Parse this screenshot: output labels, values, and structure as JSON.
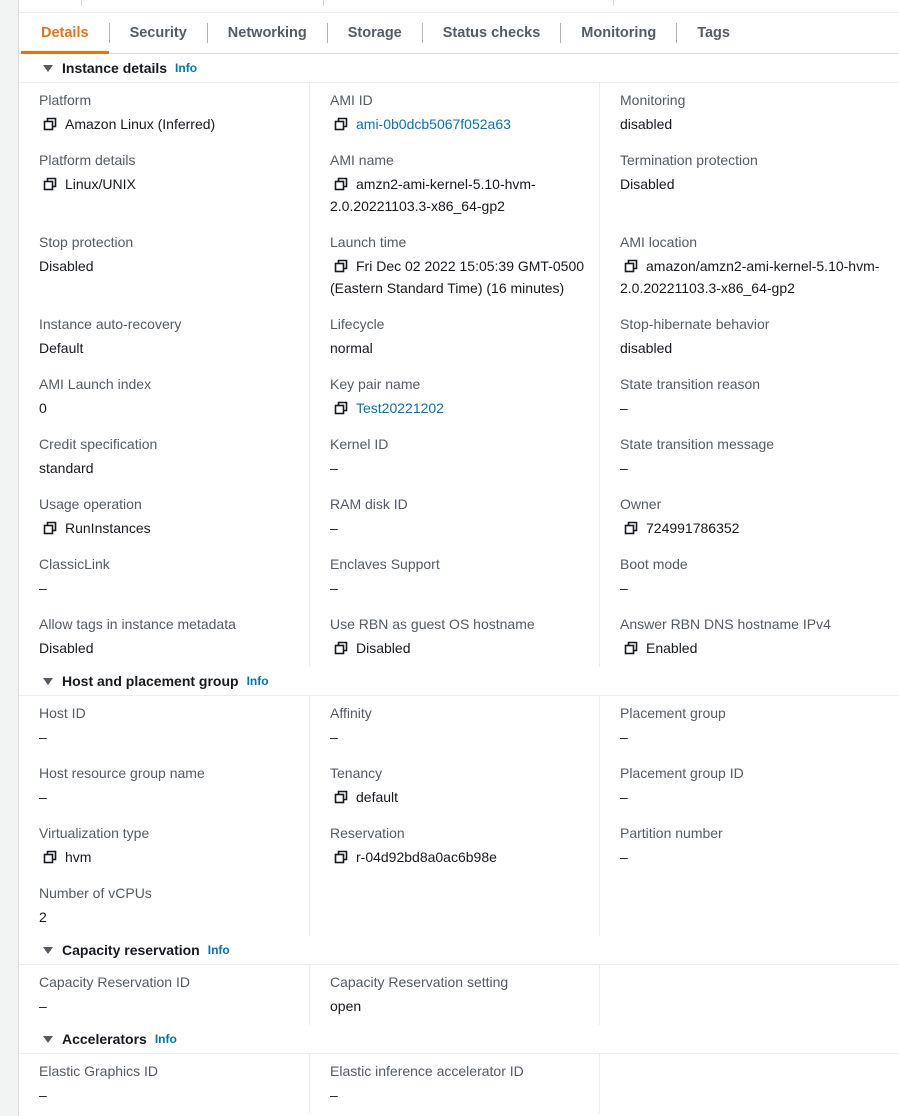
{
  "tabs": [
    "Details",
    "Security",
    "Networking",
    "Storage",
    "Status checks",
    "Monitoring",
    "Tags"
  ],
  "info_label": "Info",
  "sections": {
    "instance_details": {
      "title": "Instance details",
      "fields": [
        {
          "label": "Platform",
          "value": "Amazon Linux (Inferred)",
          "copy": true
        },
        {
          "label": "AMI ID",
          "value": "ami-0b0dcb5067f052a63",
          "copy": true,
          "link": true
        },
        {
          "label": "Monitoring",
          "value": "disabled"
        },
        {
          "label": "Platform details",
          "value": "Linux/UNIX",
          "copy": true
        },
        {
          "label": "AMI name",
          "value": "amzn2-ami-kernel-5.10-hvm-2.0.20221103.3-x86_64-gp2",
          "copy": true
        },
        {
          "label": "Termination protection",
          "value": "Disabled"
        },
        {
          "label": "Stop protection",
          "value": "Disabled"
        },
        {
          "label": "Launch time",
          "value": "Fri Dec 02 2022 15:05:39 GMT-0500 (Eastern Standard Time) (16 minutes)",
          "copy": true
        },
        {
          "label": "AMI location",
          "value": "amazon/amzn2-ami-kernel-5.10-hvm-2.0.20221103.3-x86_64-gp2",
          "copy": true
        },
        {
          "label": "Instance auto-recovery",
          "value": "Default"
        },
        {
          "label": "Lifecycle",
          "value": "normal"
        },
        {
          "label": "Stop-hibernate behavior",
          "value": "disabled"
        },
        {
          "label": "AMI Launch index",
          "value": "0"
        },
        {
          "label": "Key pair name",
          "value": "Test20221202",
          "copy": true,
          "link": true
        },
        {
          "label": "State transition reason",
          "value": "–"
        },
        {
          "label": "Credit specification",
          "value": "standard"
        },
        {
          "label": "Kernel ID",
          "value": "–"
        },
        {
          "label": "State transition message",
          "value": "–"
        },
        {
          "label": "Usage operation",
          "value": "RunInstances",
          "copy": true
        },
        {
          "label": "RAM disk ID",
          "value": "–"
        },
        {
          "label": "Owner",
          "value": "724991786352",
          "copy": true
        },
        {
          "label": "ClassicLink",
          "value": "–"
        },
        {
          "label": "Enclaves Support",
          "value": "–"
        },
        {
          "label": "Boot mode",
          "value": "–"
        },
        {
          "label": "Allow tags in instance metadata",
          "value": "Disabled"
        },
        {
          "label": "Use RBN as guest OS hostname",
          "value": "Disabled",
          "copy": true
        },
        {
          "label": "Answer RBN DNS hostname IPv4",
          "value": "Enabled",
          "copy": true
        }
      ]
    },
    "host_placement": {
      "title": "Host and placement group",
      "fields": [
        {
          "label": "Host ID",
          "value": "–"
        },
        {
          "label": "Affinity",
          "value": "–"
        },
        {
          "label": "Placement group",
          "value": "–"
        },
        {
          "label": "Host resource group name",
          "value": "–"
        },
        {
          "label": "Tenancy",
          "value": "default",
          "copy": true
        },
        {
          "label": "Placement group ID",
          "value": "–"
        },
        {
          "label": "Virtualization type",
          "value": "hvm",
          "copy": true
        },
        {
          "label": "Reservation",
          "value": "r-04d92bd8a0ac6b98e",
          "copy": true
        },
        {
          "label": "Partition number",
          "value": "–"
        },
        {
          "label": "Number of vCPUs",
          "value": "2"
        }
      ]
    },
    "capacity_reservation": {
      "title": "Capacity reservation",
      "fields": [
        {
          "label": "Capacity Reservation ID",
          "value": "–"
        },
        {
          "label": "Capacity Reservation setting",
          "value": "open"
        }
      ]
    },
    "accelerators": {
      "title": "Accelerators",
      "fields": [
        {
          "label": "Elastic Graphics ID",
          "value": "–"
        },
        {
          "label": "Elastic inference accelerator ID",
          "value": "–"
        }
      ]
    }
  },
  "colors": {
    "accent": "#ec7211",
    "link": "#0073bb",
    "label": "#545b64",
    "text": "#16191f"
  }
}
